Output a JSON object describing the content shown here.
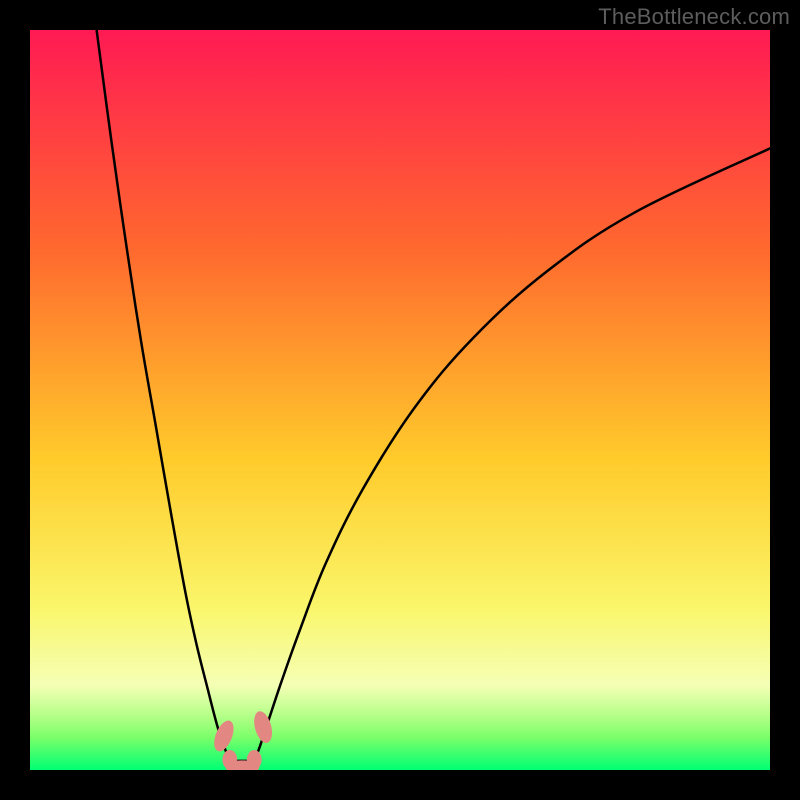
{
  "watermark": "TheBottleneck.com",
  "colors": {
    "black": "#000000",
    "watermark": "#5d5d5d",
    "curve": "#000000",
    "blob": "#e38782",
    "grad_top": "#ff1a53",
    "grad_mid1": "#ff6a2e",
    "grad_mid2": "#ffcb2b",
    "grad_mid3": "#faf66a",
    "grad_band_light": "#f5ffb5",
    "grad_band_green1": "#b7ff8a",
    "grad_band_green2": "#7dff6a",
    "grad_bottom": "#00ff73"
  },
  "chart_data": {
    "type": "line",
    "title": "",
    "xlabel": "",
    "ylabel": "",
    "xlim": [
      0,
      100
    ],
    "ylim": [
      0,
      100
    ],
    "series": [
      {
        "name": "left-branch",
        "x": [
          9.0,
          11.0,
          13.0,
          15.0,
          17.0,
          19.0,
          21.0,
          22.5,
          24.0,
          25.3,
          26.3,
          27.0
        ],
        "y": [
          100.0,
          85.0,
          71.0,
          58.0,
          46.5,
          35.0,
          24.0,
          17.0,
          11.0,
          6.0,
          3.0,
          1.2
        ]
      },
      {
        "name": "right-branch",
        "x": [
          30.3,
          31.0,
          32.0,
          34.0,
          36.5,
          40.0,
          45.0,
          52.0,
          60.0,
          70.0,
          82.0,
          100.0
        ],
        "y": [
          1.2,
          3.0,
          6.0,
          12.0,
          19.0,
          28.0,
          38.0,
          49.0,
          58.5,
          67.5,
          75.5,
          84.0
        ]
      },
      {
        "name": "floor",
        "x": [
          27.0,
          30.3
        ],
        "y": [
          1.2,
          1.2
        ]
      }
    ],
    "markers": [
      {
        "name": "blob-left-top",
        "cx": 26.2,
        "cy": 4.6,
        "rx": 1.1,
        "ry": 2.2,
        "angle": 22
      },
      {
        "name": "blob-left-bottom",
        "cx": 27.0,
        "cy": 1.4,
        "rx": 1.0,
        "ry": 1.3,
        "angle": 0
      },
      {
        "name": "blob-right-bottom",
        "cx": 30.3,
        "cy": 1.4,
        "rx": 1.0,
        "ry": 1.3,
        "angle": 0
      },
      {
        "name": "blob-right-top",
        "cx": 31.5,
        "cy": 5.8,
        "rx": 1.1,
        "ry": 2.2,
        "angle": -15
      },
      {
        "name": "blob-floor",
        "cx": 28.7,
        "cy": 0.4,
        "rx": 2.3,
        "ry": 0.9,
        "angle": 0
      }
    ],
    "gradient_stops": [
      {
        "offset": 0.0,
        "color_key": "grad_top"
      },
      {
        "offset": 0.3,
        "color_key": "grad_mid1"
      },
      {
        "offset": 0.58,
        "color_key": "grad_mid2"
      },
      {
        "offset": 0.78,
        "color_key": "grad_mid3"
      },
      {
        "offset": 0.885,
        "color_key": "grad_band_light"
      },
      {
        "offset": 0.925,
        "color_key": "grad_band_green1"
      },
      {
        "offset": 0.955,
        "color_key": "grad_band_green2"
      },
      {
        "offset": 1.0,
        "color_key": "grad_bottom"
      }
    ]
  }
}
